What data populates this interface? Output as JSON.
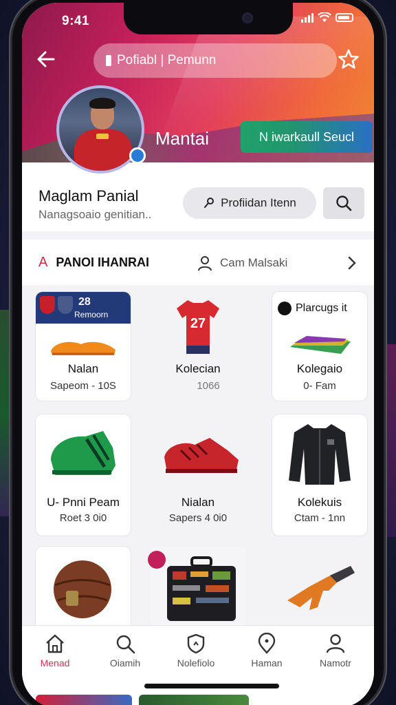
{
  "status": {
    "time": "9:41"
  },
  "topbar": {
    "search_label": "Pofiabl | Pemunn"
  },
  "hero": {
    "name": "Mantai",
    "button_label": "N iwarkaull Seucl"
  },
  "profile": {
    "title": "Maglam Panial",
    "subtitle": "Nanagsoaio genitian..",
    "pill_label": "Profiidan Itenn"
  },
  "tabs": {
    "primary": "PANOI IHANRAI",
    "secondary": "Cam Malsaki"
  },
  "cards": [
    {
      "banner_number": "28",
      "banner_text": "Remoorn",
      "label": "Nalan",
      "sub": "Sapeom - 10S"
    },
    {
      "jersey_number": "27",
      "label": "Kolecian",
      "sub": "1066"
    },
    {
      "header": "Plarcugs it",
      "label": "Kolegaio",
      "sub": "0- Fam"
    },
    {
      "label": "U- Pnni Peam",
      "sub": "Roet 3 0i0"
    },
    {
      "label": "Nialan",
      "sub": "Sapers 4 0i0"
    },
    {
      "label": "Kolekuis",
      "sub": "Ctam - 1nn"
    }
  ],
  "nav": [
    {
      "label": "Menad",
      "icon": "home-icon",
      "active": true
    },
    {
      "label": "Oiamih",
      "icon": "search-icon",
      "active": false
    },
    {
      "label": "Nolefiolo",
      "icon": "shield-icon",
      "active": false
    },
    {
      "label": "Haman",
      "icon": "location-icon",
      "active": false
    },
    {
      "label": "Namotr",
      "icon": "user-icon",
      "active": false
    }
  ],
  "colors": {
    "accent": "#c63b55",
    "hero_start": "#8e1a4a",
    "hero_end": "#ef8a30",
    "button_green": "#1fa26a",
    "button_blue": "#2a6fc6"
  }
}
